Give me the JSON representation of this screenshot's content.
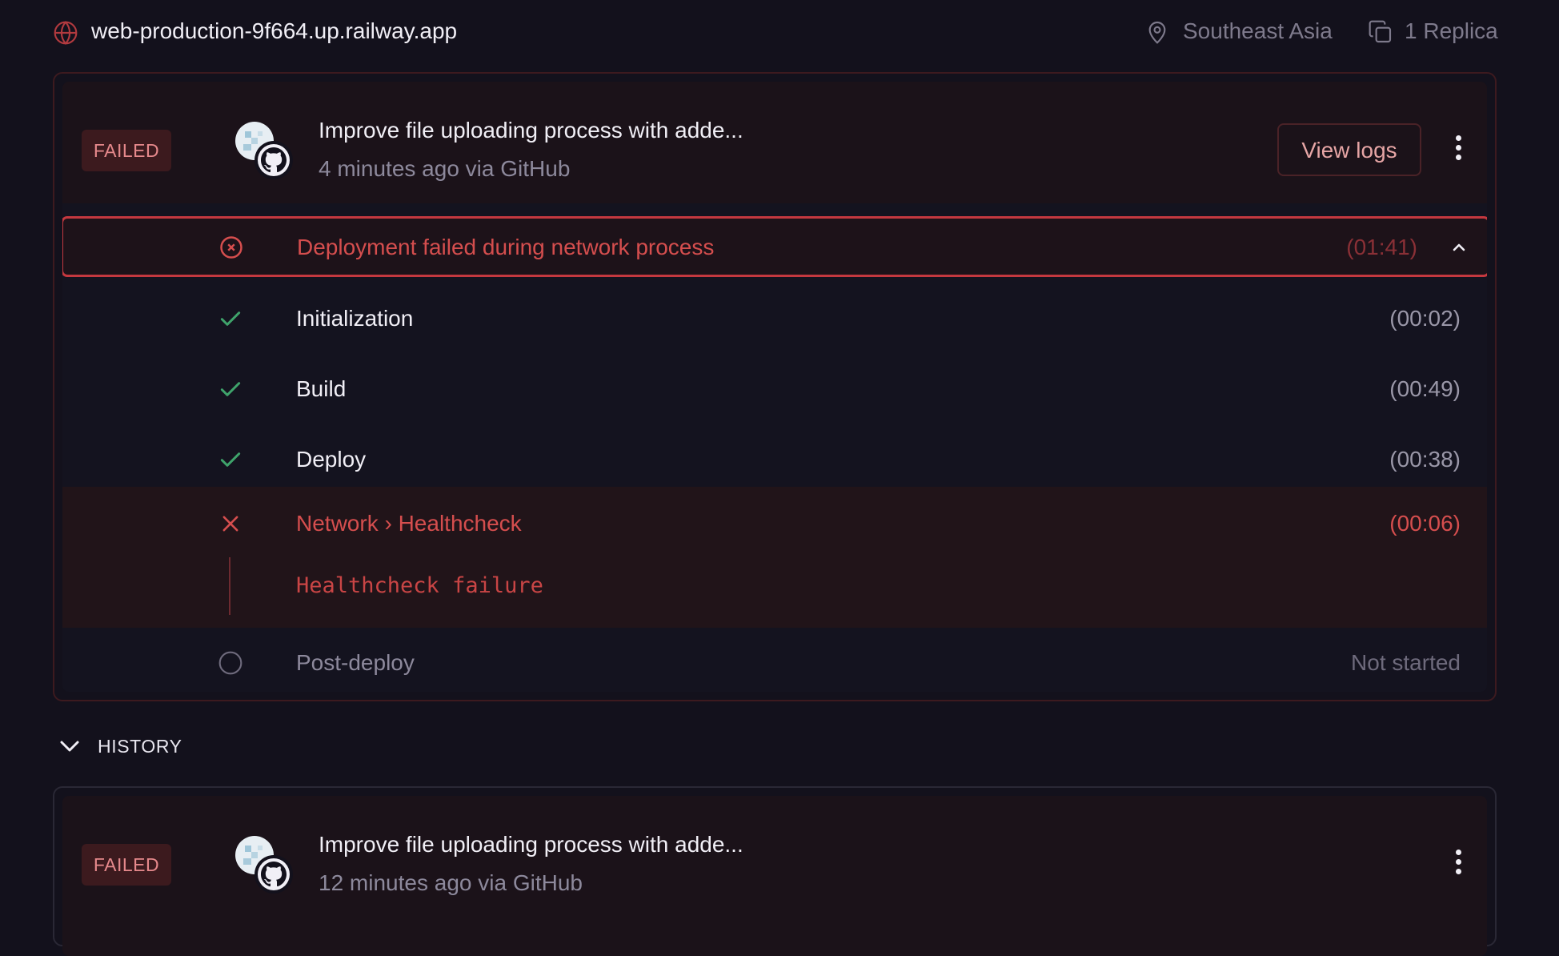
{
  "topbar": {
    "domain": "web-production-9f664.up.railway.app",
    "region": "Southeast Asia",
    "replicas": "1 Replica",
    "icons": {
      "domain": "globe-icon",
      "region": "map-pin-icon",
      "replicas": "copy-icon"
    }
  },
  "deployment": {
    "status": "FAILED",
    "commit_title": "Improve file uploading process with adde...",
    "meta": "4 minutes ago via GitHub",
    "view_logs_label": "View logs",
    "error": {
      "message": "Deployment failed during network process",
      "time": "(01:41)"
    },
    "steps": [
      {
        "label": "Initialization",
        "time": "(00:02)",
        "state": "success"
      },
      {
        "label": "Build",
        "time": "(00:49)",
        "state": "success"
      },
      {
        "label": "Deploy",
        "time": "(00:38)",
        "state": "success"
      },
      {
        "label": "Network › Healthcheck",
        "time": "(00:06)",
        "state": "failed",
        "detail": "Healthcheck failure"
      },
      {
        "label": "Post-deploy",
        "time": "Not started",
        "state": "pending"
      }
    ]
  },
  "history": {
    "label": "HISTORY",
    "items": [
      {
        "status": "FAILED",
        "commit_title": "Improve file uploading process with adde...",
        "meta": "12 minutes ago via GitHub"
      }
    ]
  },
  "colors": {
    "background": "#13111c",
    "failed_red": "#d54e4e",
    "success_green": "#3fa36b",
    "badge_bg": "#3c1a1e"
  }
}
